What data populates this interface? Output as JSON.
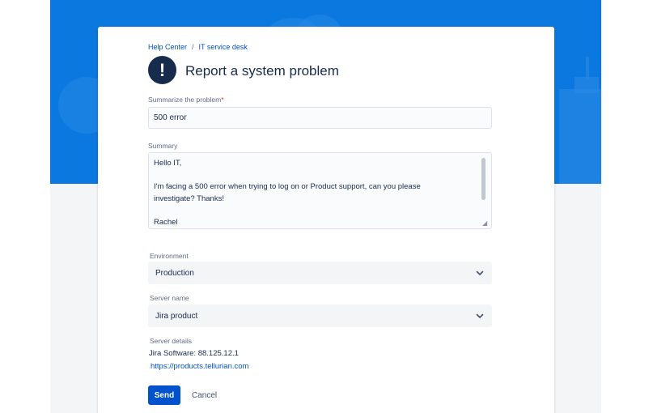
{
  "breadcrumb": {
    "home": "Help Center",
    "separator": "/",
    "desk": "IT service desk"
  },
  "header": {
    "title": "Report a system problem",
    "icon_glyph": "!"
  },
  "form": {
    "summary_label": "Summarize the problem",
    "required_marker": "*",
    "summary_value": "500 error",
    "description_label": "Summary",
    "description_lines": [
      "Hello IT,",
      "",
      "I'm facing a 500 error when trying to log on or Product support, can you please",
      "investigate? Thanks!",
      "",
      "Rachel"
    ],
    "environment_label": "Environment",
    "environment_value": "Production",
    "server_label": "Server name",
    "server_value": "Jira product",
    "details_label": "Server details",
    "details_text": "Jira Software: 88.125.12.1",
    "details_link": "https://products.tellurian.com"
  },
  "actions": {
    "send_label": "Send",
    "cancel_label": "Cancel"
  },
  "icons": {
    "title_icon": "exclamation-icon",
    "select_icon": "chevron-down-icon"
  },
  "colors": {
    "banner": "#0a78de",
    "primary": "#0052cc",
    "text": "#172b4d",
    "required": "#de350b"
  }
}
